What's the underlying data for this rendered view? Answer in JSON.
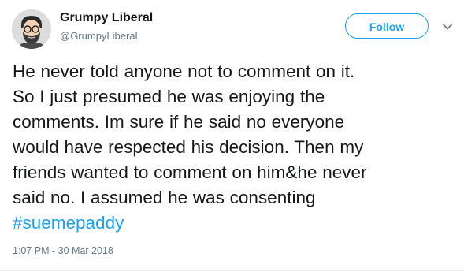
{
  "author": {
    "display_name": "Grumpy Liberal",
    "handle": "@GrumpyLiberal",
    "avatar_icon": "bearded-man-avatar-icon"
  },
  "actions": {
    "follow_label": "Follow",
    "menu_icon": "chevron-down-icon"
  },
  "tweet": {
    "lines": [
      "He never told anyone not to comment on it.",
      "So I just presumed he was enjoying the",
      "comments. Im sure if he said no everyone",
      "would have respected his decision. Then my",
      "friends wanted to comment on him&he never",
      "said no. I assumed he was consenting"
    ],
    "hashtag": "#suemepaddy",
    "timestamp": "1:07 PM - 30 Mar 2018"
  },
  "colors": {
    "accent": "#1da1f2",
    "text": "#14171a",
    "secondary_text": "#657786"
  }
}
